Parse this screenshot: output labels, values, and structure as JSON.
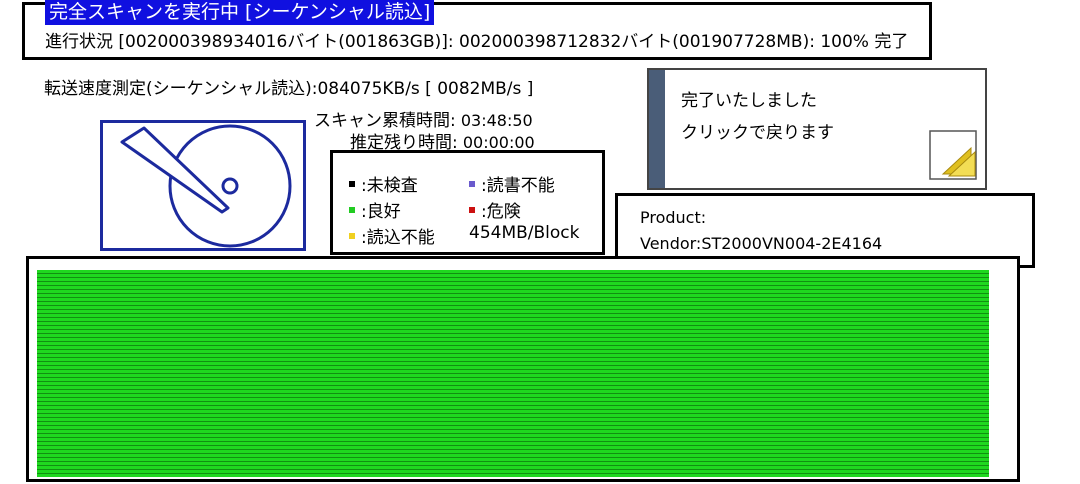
{
  "header": {
    "title": "完全スキャンを実行中 [シーケンシャル読込]",
    "progress_label": "進行状況",
    "progress_text": "[002000398934016バイト(001863GB)]: 002000398712832バイト(001907728MB): 100% 完了"
  },
  "speed": {
    "label": "転送速度測定(シーケンシャル読込):",
    "value": "084075KB/s [ 0082MB/s ]"
  },
  "times": {
    "elapsed_label": "スキャン累積時間:",
    "elapsed_value": "03:48:50",
    "remaining_label": "推定残り時間:",
    "remaining_value": "00:00:00"
  },
  "legend": {
    "items": [
      {
        "label": ":未検査",
        "color": "#000000"
      },
      {
        "label": ":読書不能",
        "color": "#6a5acd"
      },
      {
        "label": ":良好",
        "color": "#22cc22"
      },
      {
        "label": ":危険",
        "color": "#cc1111"
      },
      {
        "label": ":読込不能",
        "color": "#f0d020"
      }
    ],
    "block_size": "454MB/Block"
  },
  "dialog": {
    "line1": "完了いたしました",
    "line2": "クリックで戻ります",
    "accent": "#4a5d78"
  },
  "product": {
    "product_line": "Product:",
    "vendor_line": "Vendor:ST2000VN004-2E4164"
  },
  "map": {
    "good_color": "#1fd81f",
    "status": "良好"
  },
  "icons": {
    "disk": "hard-disk-icon",
    "return": "return-pages-icon"
  }
}
